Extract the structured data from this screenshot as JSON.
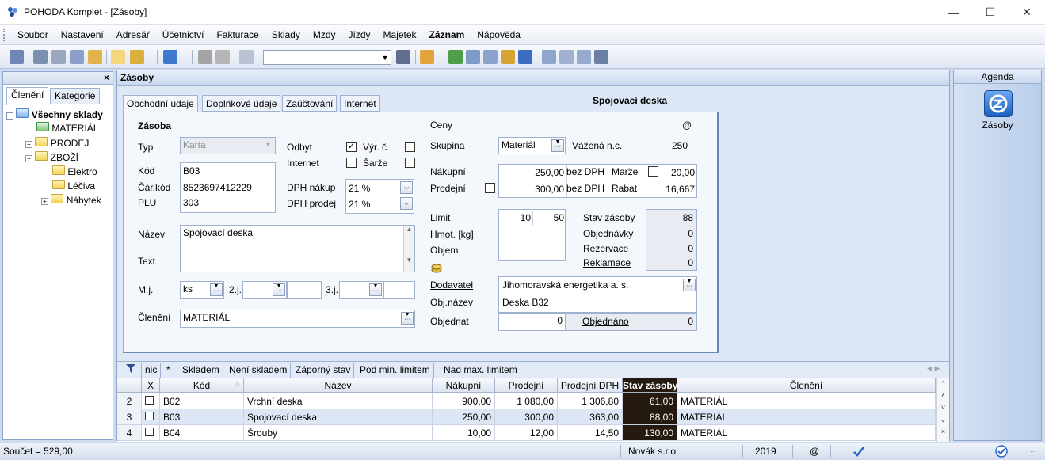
{
  "window": {
    "title": "POHODA Komplet - [Zásoby]"
  },
  "menu": [
    "Soubor",
    "Nastavení",
    "Adresář",
    "Účetnictví",
    "Fakturace",
    "Sklady",
    "Mzdy",
    "Jízdy",
    "Majetek",
    "Záznam",
    "Nápověda"
  ],
  "left": {
    "tabs": [
      "Členění",
      "Kategorie"
    ],
    "tree": {
      "root": "Všechny sklady",
      "material": "MATERIÁL",
      "prodej": "PRODEJ",
      "zbozi": "ZBOŽÍ",
      "elektro": "Elektro",
      "leciva": "Léčiva",
      "nabytek": "Nábytek"
    }
  },
  "main": {
    "caption": "Zásoby",
    "tabs": [
      "Obchodní údaje",
      "Doplňkové údaje",
      "Zaúčtování",
      "Internet"
    ],
    "detail_title": "Spojovací deska"
  },
  "form": {
    "section_zasoba": "Zásoba",
    "typ_label": "Typ",
    "typ_value": "Karta",
    "odbyt_label": "Odbyt",
    "vyr_label": "Výr. č.",
    "internet_label": "Internet",
    "sarze_label": "Šarže",
    "kod_label": "Kód",
    "kod_value": "B03",
    "carkod_label": "Čár.kód",
    "carkod_value": "8523697412229",
    "plu_label": "PLU",
    "plu_value": "303",
    "dph_nakup_label": "DPH nákup",
    "dph_nakup_value": "21 %",
    "dph_prodej_label": "DPH prodej",
    "dph_prodej_value": "21 %",
    "nazev_label": "Název",
    "nazev_value": "Spojovací deska",
    "text_label": "Text",
    "mj_label": "M.j.",
    "mj_value": "ks",
    "j2_label": "2.j.",
    "j3_label": "3.j.",
    "cleneni_label": "Členění",
    "cleneni_value": "MATERIÁL",
    "ceny_label": "Ceny",
    "at_sign": "@",
    "skupina_label": "Skupina",
    "skupina_value": "Materiál",
    "vazena_label": "Vážená n.c.",
    "vazena_value": "250",
    "nakupni_label": "Nákupní",
    "nakupni_value": "250,00",
    "bez_dph1": "bez DPH",
    "marze_label": "Marže",
    "marze_value": "20,00",
    "prodejni_label": "Prodejní",
    "prodejni_value": "300,00",
    "bez_dph2": "bez DPH",
    "rabat_label": "Rabat",
    "rabat_value": "16,667",
    "limit_label": "Limit",
    "limit_min": "10",
    "limit_max": "50",
    "hmot_label": "Hmot. [kg]",
    "objem_label": "Objem",
    "stav_label": "Stav zásoby",
    "stav_value": "88",
    "objednavky_label": "Objednávky",
    "objednavky_value": "0",
    "rezervace_label": "Rezervace",
    "rezervace_value": "0",
    "reklamace_label": "Reklamace",
    "reklamace_value": "0",
    "dodavatel_label": "Dodavatel",
    "dodavatel_value": "Jihomoravská energetika a. s.",
    "objnazev_label": "Obj.název",
    "objnazev_value": "Deska B32",
    "objednat_label": "Objednat",
    "objednat_value": "0",
    "objednano_label": "Objednáno",
    "objednano_value": "0"
  },
  "filters": [
    "nic",
    "*",
    "Skladem",
    "Není skladem",
    "Záporný stav",
    "Pod min. limitem",
    "Nad max. limitem"
  ],
  "grid": {
    "headers": [
      "X",
      "Kód",
      "Název",
      "Nákupní",
      "Prodejní",
      "Prodejní DPH",
      "Stav zásoby",
      "Členění"
    ],
    "rows": [
      {
        "n": "2",
        "kod": "B02",
        "nazev": "Vrchní deska",
        "nakupni": "900,00",
        "prodejni": "1 080,00",
        "prodejni_dph": "1 306,80",
        "stav": "61,00",
        "cleneni": "MATERIÁL"
      },
      {
        "n": "3",
        "kod": "B03",
        "nazev": "Spojovací deska",
        "nakupni": "250,00",
        "prodejni": "300,00",
        "prodejni_dph": "363,00",
        "stav": "88,00",
        "cleneni": "MATERIÁL"
      },
      {
        "n": "4",
        "kod": "B04",
        "nazev": "Šrouby",
        "nakupni": "10,00",
        "prodejni": "12,00",
        "prodejni_dph": "14,50",
        "stav": "130,00",
        "cleneni": "MATERIÁL"
      }
    ]
  },
  "right": {
    "head": "Agenda",
    "item": "Zásoby"
  },
  "status": {
    "sum": "Součet = 529,00",
    "company": "Novák s.r.o.",
    "year": "2019",
    "at": "@"
  },
  "colors": {
    "accent": "#1e5fbf",
    "stock_cell": "#241a10"
  }
}
